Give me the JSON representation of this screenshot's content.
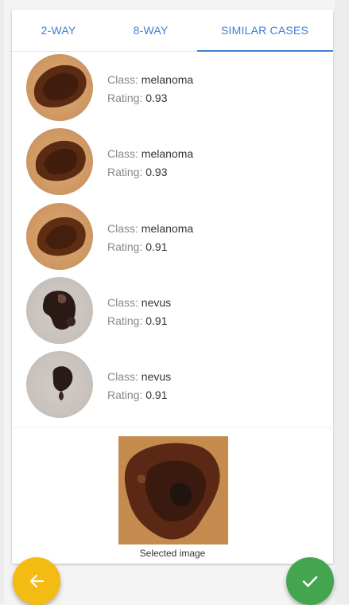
{
  "tabs": [
    {
      "label": "2-WAY"
    },
    {
      "label": "8-WAY"
    },
    {
      "label": "SIMILAR CASES",
      "active": true
    }
  ],
  "labels": {
    "class_prefix": "Class:",
    "rating_prefix": "Rating:"
  },
  "cases": [
    {
      "class": "melanoma",
      "rating": "0.93",
      "thumb_type": "melanoma-lesion"
    },
    {
      "class": "melanoma",
      "rating": "0.93",
      "thumb_type": "melanoma-lesion"
    },
    {
      "class": "melanoma",
      "rating": "0.91",
      "thumb_type": "melanoma-lesion"
    },
    {
      "class": "nevus",
      "rating": "0.91",
      "thumb_type": "nevus-lesion"
    },
    {
      "class": "nevus",
      "rating": "0.91",
      "thumb_type": "nevus-lesion"
    }
  ],
  "selected": {
    "caption": "Selected image"
  },
  "buttons": {
    "back_icon": "arrow-left-icon",
    "confirm_icon": "check-icon"
  },
  "colors": {
    "accent": "#3f7fd9",
    "back": "#f4bb12",
    "confirm": "#43a64f"
  }
}
